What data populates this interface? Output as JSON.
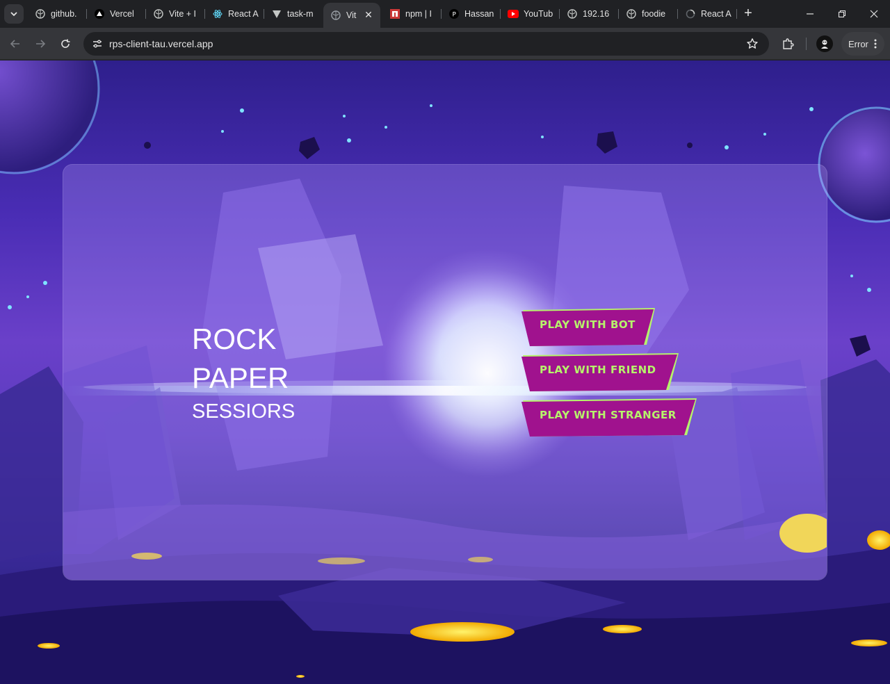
{
  "browser": {
    "tabs": [
      {
        "title": "github.",
        "icon": "globe-icon"
      },
      {
        "title": "Vercel",
        "icon": "vercel-icon"
      },
      {
        "title": "Vite + I",
        "icon": "globe-icon"
      },
      {
        "title": "React A",
        "icon": "react-icon"
      },
      {
        "title": "task-m",
        "icon": "vite-icon"
      },
      {
        "title": "Vit",
        "icon": "globe-icon",
        "active": true
      },
      {
        "title": "npm | I",
        "icon": "npm-icon"
      },
      {
        "title": "Hassan",
        "icon": "p-icon"
      },
      {
        "title": "YouTub",
        "icon": "youtube-icon"
      },
      {
        "title": "192.16",
        "icon": "globe-icon"
      },
      {
        "title": "foodie",
        "icon": "globe-icon"
      },
      {
        "title": "React A",
        "icon": "react-loading-icon"
      }
    ],
    "url": "rps-client-tau.vercel.app",
    "error_label": "Error"
  },
  "page": {
    "title_line1": "ROCK",
    "title_line2": "PAPER",
    "title_line3": "SESSIORS",
    "buttons": {
      "bot": "PLAY WITH BOT",
      "friend": "PLAY WITH FRIEND",
      "stranger": "PLAY WITH STRANGER"
    }
  },
  "colors": {
    "button_fill": "#a0128e",
    "button_text": "#b6f36b",
    "button_edge": "#b6f36b"
  }
}
